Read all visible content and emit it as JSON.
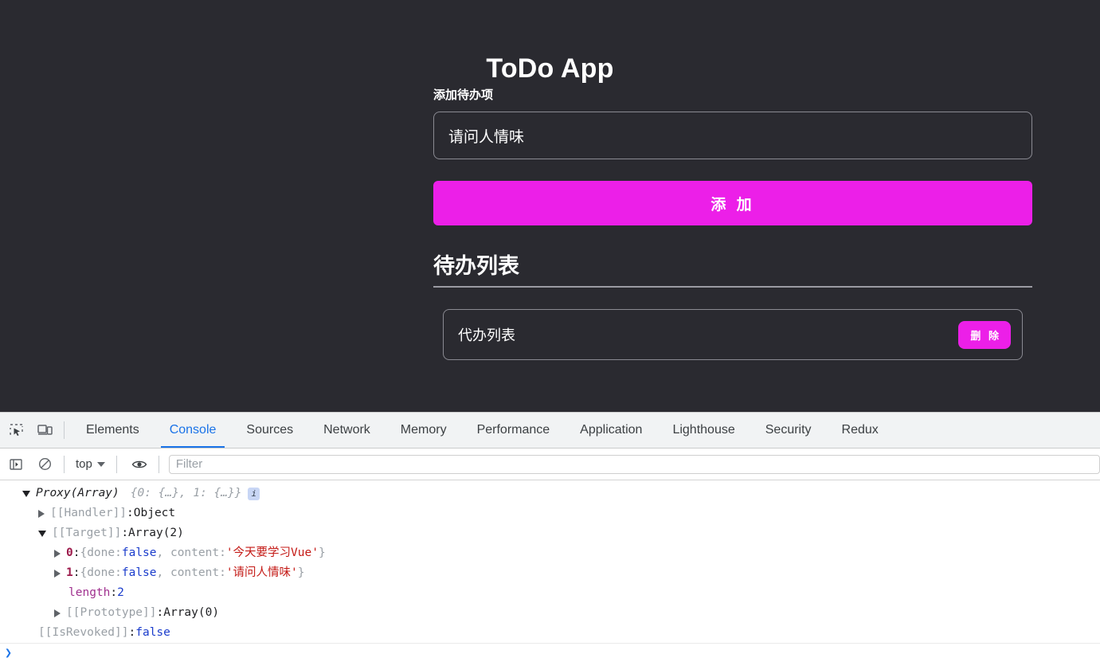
{
  "page": {
    "title": "ToDo App",
    "add_label": "添加待办项",
    "input_value": "请问人情味",
    "input_placeholder": "",
    "add_button": "添 加",
    "list_heading": "待办列表",
    "todos": [
      {
        "text": "代办列表",
        "delete_label": "删 除"
      }
    ]
  },
  "colors": {
    "page_bg": "#2a2a30",
    "accent": "#ec1fe8",
    "text": "#ffffff",
    "border": "#8a8a92",
    "devtools_active": "#1a73e8"
  },
  "devtools": {
    "icons": {
      "inspect": "inspect-element-icon",
      "device": "device-toolbar-icon",
      "sidebar": "console-sidebar-icon",
      "clear": "clear-console-icon",
      "eye": "live-expression-icon"
    },
    "tabs": [
      {
        "label": "Elements",
        "active": false
      },
      {
        "label": "Console",
        "active": true
      },
      {
        "label": "Sources",
        "active": false
      },
      {
        "label": "Network",
        "active": false
      },
      {
        "label": "Memory",
        "active": false
      },
      {
        "label": "Performance",
        "active": false
      },
      {
        "label": "Application",
        "active": false
      },
      {
        "label": "Lighthouse",
        "active": false
      },
      {
        "label": "Security",
        "active": false
      },
      {
        "label": "Redux",
        "active": false
      }
    ],
    "context": "top",
    "filter_placeholder": "Filter",
    "filter_value": "",
    "prompt_chevron": "❯",
    "console": {
      "line0": {
        "name": "Proxy(Array)",
        "preview": "{0: {…}, 1: {…}}",
        "badge": "i"
      },
      "line1": {
        "key": "[[Handler]]",
        "sep": ": ",
        "value": "Object"
      },
      "line2": {
        "key": "[[Target]]",
        "sep": ": ",
        "value": "Array(2)"
      },
      "line3": {
        "index": "0",
        "sep": ": ",
        "open": "{done: ",
        "bool": "false",
        "mid": ", content: ",
        "str": "'今天要学习Vue'",
        "close": "}"
      },
      "line4": {
        "index": "1",
        "sep": ": ",
        "open": "{done: ",
        "bool": "false",
        "mid": ", content: ",
        "str": "'请问人情味'",
        "close": "}"
      },
      "line5": {
        "key": "length",
        "sep": ": ",
        "value": "2"
      },
      "line6": {
        "key": "[[Prototype]]",
        "sep": ": ",
        "value": "Array(0)"
      },
      "line7": {
        "key": "[[IsRevoked]]",
        "sep": ": ",
        "value": "false"
      }
    }
  }
}
